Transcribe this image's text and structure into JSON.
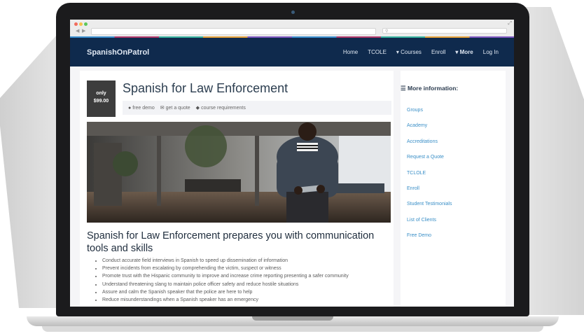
{
  "site": {
    "brand": "SpanishOnPatrol",
    "nav": [
      "Home",
      "TCOLE",
      "▾ Courses",
      "Enroll",
      "▾ More",
      "Log In"
    ]
  },
  "course": {
    "price_top": "only",
    "price_value": "$99.00",
    "title": "Spanish for Law Enforcement",
    "meta": [
      {
        "icon": "user-icon",
        "label": "free demo"
      },
      {
        "icon": "comments-icon",
        "label": "get a quote"
      },
      {
        "icon": "tag-icon",
        "label": "course requirements"
      }
    ],
    "heading": "Spanish for Law Enforcement prepares you with communication tools and skills",
    "bullets": [
      "Conduct accurate field interviews in Spanish to speed up dissemination of information",
      "Prevent incidents from escalating by comprehending the victim, suspect or witness",
      "Promote trust with the Hispanic community to improve and increase crime reporting presenting a safer community",
      "Understand threatening slang to maintain police officer safety and reduce hostile situations",
      "Assure and calm the Spanish speaker that the police are here to help",
      "Reduce misunderstandings when a Spanish speaker has an emergency"
    ]
  },
  "sidebar": {
    "title": "More information:",
    "links": [
      "Groups",
      "Academy",
      "Accreditations",
      "Request a Quote",
      "TCLOLE",
      "Enroll",
      "Student Testimonials",
      "List of Clients",
      "Free Demo"
    ]
  },
  "colors": {
    "nav_bg": "#0f2a4d",
    "price_bg": "#3d3d3d",
    "link": "#3a8fc7"
  }
}
